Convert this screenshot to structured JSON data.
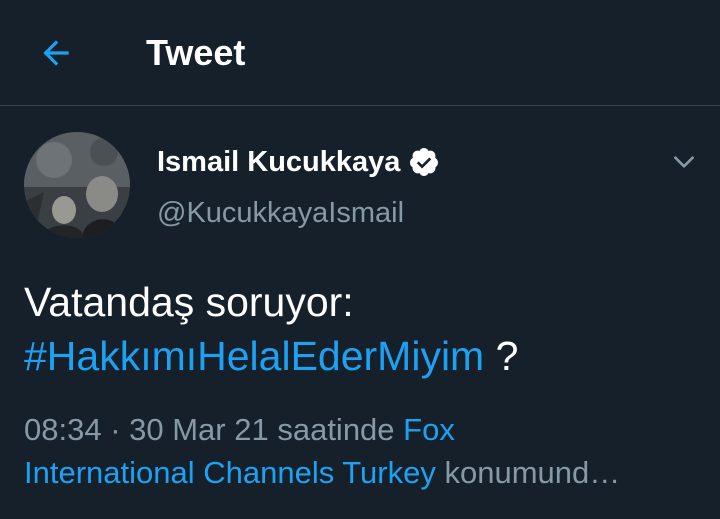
{
  "header": {
    "title": "Tweet",
    "back_icon": "arrow-left-icon"
  },
  "colors": {
    "background": "#15202b",
    "accent": "#1da1f2",
    "secondary_text": "#8899a6",
    "divider": "#38444d"
  },
  "author": {
    "display_name": "Ismail Kucukkaya",
    "handle": "@KucukkayaIsmail",
    "verified_icon": "verified-badge-icon",
    "more_icon": "chevron-down-icon"
  },
  "tweet": {
    "text_line1": "Vatandaş soruyor:",
    "hashtag": "#HakkımıHelalEderMiyim",
    "text_after_hashtag": " ?"
  },
  "meta": {
    "time": "08:34",
    "separator": " · ",
    "date": "30 Mar 21",
    "date_suffix": " saatinde ",
    "location_part1": "Fox",
    "location_part2": "International Channels Turkey",
    "location_suffix": " konumund…"
  }
}
